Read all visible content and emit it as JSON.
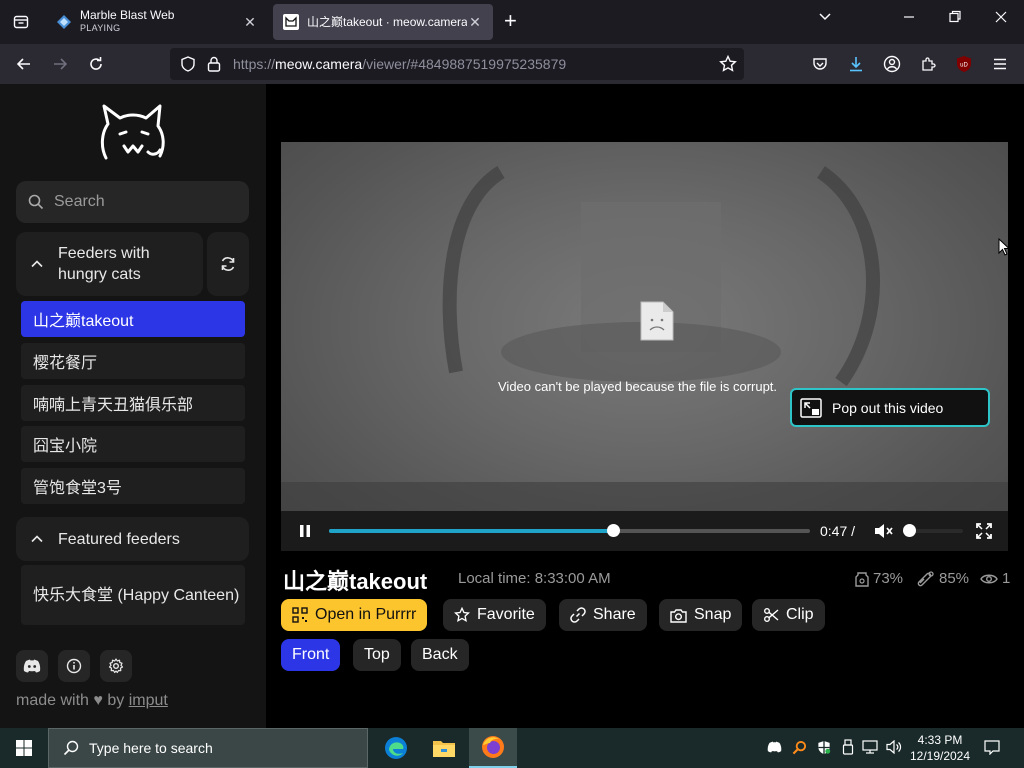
{
  "browser": {
    "tabs": [
      {
        "title": "Marble Blast Web",
        "subtitle": "PLAYING"
      },
      {
        "title": "山之巅takeout · meow.camera"
      }
    ],
    "url_prefix": "https://",
    "url_host": "meow.camera",
    "url_path": "/viewer/#4849887519975235879"
  },
  "sidebar": {
    "search_placeholder": "Search",
    "group_hungry": "Feeders with hungry cats",
    "feeders": [
      "山之巅takeout",
      "樱花餐厅",
      "喃喃上青天丑猫俱乐部",
      "囧宝小院",
      "管饱食堂3号"
    ],
    "group_featured": "Featured feeders",
    "featured": [
      "快乐大食堂 (Happy Canteen)"
    ],
    "made_with": "made with",
    "by": "by",
    "author": "imput"
  },
  "video": {
    "error_message": "Video can't be played because the file is corrupt.",
    "popout_label": "Pop out this video",
    "time": "0:47 /",
    "progress": 0.59,
    "volume": 0.0
  },
  "camera": {
    "title": "山之巅takeout",
    "local_time": "Local time: 8:33:00 AM",
    "stat_food": "73%",
    "stat_treat": "85%",
    "stat_viewers": "1"
  },
  "actions": {
    "open_in": "Open in Purrrr",
    "favorite": "Favorite",
    "share": "Share",
    "snap": "Snap",
    "clip": "Clip"
  },
  "views": [
    "Front",
    "Top",
    "Back"
  ],
  "taskbar": {
    "search_placeholder": "Type here to search",
    "time": "4:33 PM",
    "date": "12/19/2024"
  },
  "colors": {
    "accent_blue": "#2c36e6",
    "accent_yellow": "#fcc52e",
    "progress": "#1fa3c8",
    "popout_border": "#2ec5c9"
  }
}
